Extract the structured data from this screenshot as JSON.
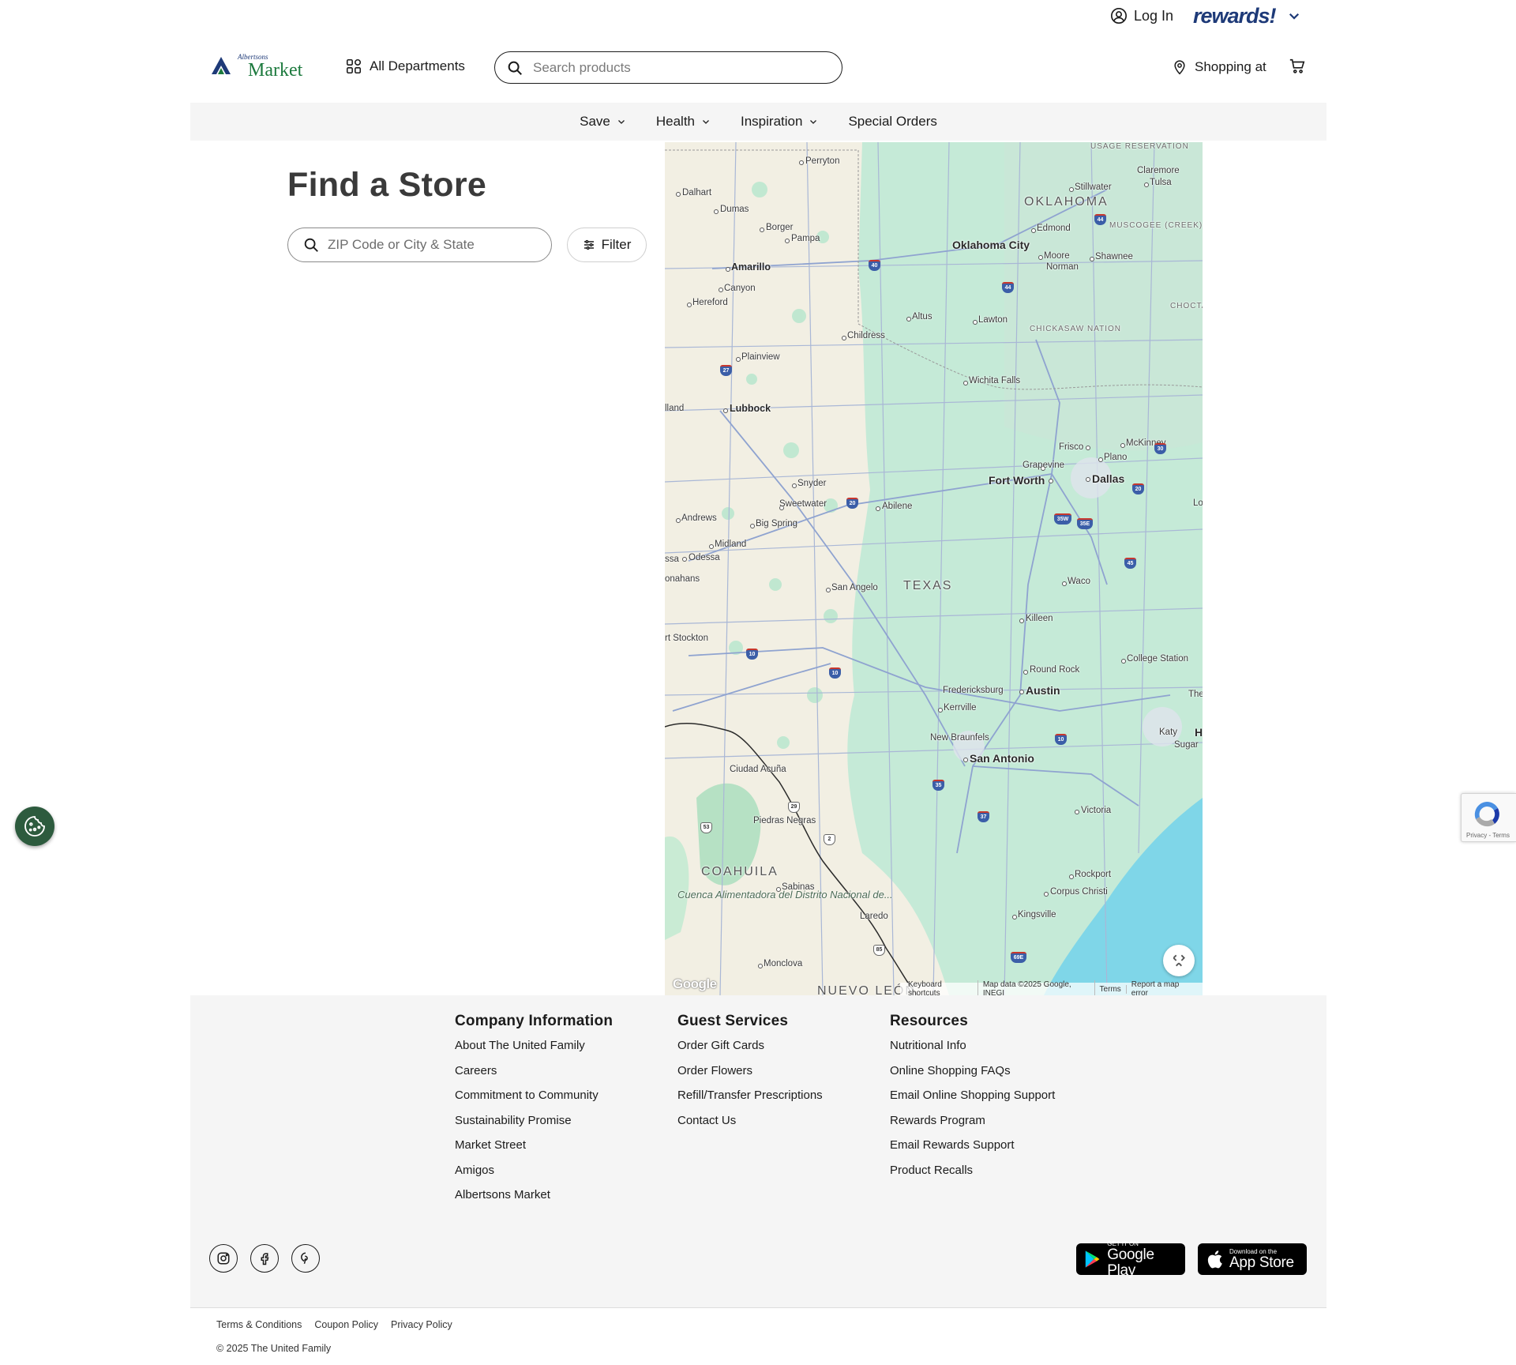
{
  "util": {
    "login_label": "Log In",
    "rewards_label": "rewards!"
  },
  "header": {
    "logo_top": "Albertsons",
    "logo_main": "Market",
    "all_departments": "All Departments",
    "search_placeholder": "Search products",
    "shopping_at": "Shopping at"
  },
  "nav": {
    "items": [
      {
        "label": "Save"
      },
      {
        "label": "Health"
      },
      {
        "label": "Inspiration"
      },
      {
        "label": "Special Orders"
      }
    ]
  },
  "store_finder": {
    "title": "Find a Store",
    "zip_placeholder": "ZIP Code or City & State",
    "filter_label": "Filter"
  },
  "map": {
    "labels": {
      "state_ok": "OKLAHOMA",
      "state_tx": "TEXAS",
      "coahuila": "COAHUILA",
      "nuevo_leon": "NUEVO LEÓN",
      "usage_res": "USAGE RESERVATION",
      "muscogee": "MUSCOGEE (CREEK) NATION",
      "chickasaw": "CHICKASAW NATION",
      "choctaw": "CHOCTA NATIO",
      "cuenca": "Cuenca Alimentadora del Distrito Nacional de...",
      "perryton": "Perryton",
      "dalhart": "Dalhart",
      "dumas": "Dumas",
      "borger": "Borger",
      "pampa": "Pampa",
      "amarillo": "Amarillo",
      "canyon": "Canyon",
      "hereford": "Hereford",
      "plainview": "Plainview",
      "lubbock": "Lubbock",
      "levelland": "lland",
      "snyder": "Snyder",
      "sweetwater": "Sweetwater",
      "abilene": "Abilene",
      "andrews": "Andrews",
      "big_spring": "Big Spring",
      "midland": "Midland",
      "odessa": "Odessa",
      "odessa_left": "ssa",
      "monahans": "onahans",
      "san_angelo": "San Angelo",
      "fort_stockton": "rt Stockton",
      "childress": "Childress",
      "altus": "Altus",
      "lawton": "Lawton",
      "wichita_falls": "Wichita Falls",
      "oklahoma_city": "Oklahoma City",
      "edmond": "Edmond",
      "moore": "Moore",
      "norman": "Norman",
      "shawnee": "Shawnee",
      "stillwater": "Stillwater",
      "tulsa": "Tulsa",
      "claremore": "Claremore",
      "frisco": "Frisco",
      "mckinney": "McKinney",
      "plano": "Plano",
      "grapevine": "Grapevine",
      "fort_worth": "Fort Worth",
      "dallas": "Dallas",
      "waco": "Waco",
      "killeen": "Killeen",
      "round_rock": "Round Rock",
      "austin": "Austin",
      "college_station": "College Station",
      "fredericksburg": "Fredericksburg",
      "kerrville": "Kerrville",
      "new_braunfels": "New Braunfels",
      "san_antonio": "San Antonio",
      "katy": "Katy",
      "sugar_land": "Sugar",
      "the_wo": "The Wo",
      "houston_h": "H",
      "victoria": "Victoria",
      "ciudad_acuna": "Ciudad Acuña",
      "piedras_negras": "Piedras Negras",
      "sabinas": "Sabinas",
      "laredo": "Laredo",
      "monclova": "Monclova",
      "rockport": "Rockport",
      "corpus_christi": "Corpus Christi",
      "kingsville": "Kingsville",
      "lo": "Lo"
    },
    "shields": [
      "40",
      "44",
      "44",
      "27",
      "30",
      "20",
      "20",
      "35W",
      "35E",
      "45",
      "10",
      "10",
      "10",
      "35",
      "37",
      "69E",
      "85",
      "29",
      "53",
      "2"
    ],
    "footer": {
      "google": "Google",
      "shortcuts": "Keyboard shortcuts",
      "map_data": "Map data ©2025 Google, INEGI",
      "terms": "Terms",
      "report": "Report a map error"
    }
  },
  "footer": {
    "company": {
      "title": "Company Information",
      "links": [
        "About The United Family",
        "Careers",
        "Commitment to Community",
        "Sustainability Promise",
        "Market Street",
        "Amigos",
        "Albertsons Market"
      ]
    },
    "guest": {
      "title": "Guest Services",
      "links": [
        "Order Gift Cards",
        "Order Flowers",
        "Refill/Transfer Prescriptions",
        "Contact Us"
      ]
    },
    "resources": {
      "title": "Resources",
      "links": [
        "Nutritional Info",
        "Online Shopping FAQs",
        "Email Online Shopping Support",
        "Rewards Program",
        "Email Rewards Support",
        "Product Recalls"
      ]
    },
    "google_play": {
      "small": "GET IT ON",
      "big": "Google Play"
    },
    "app_store": {
      "small": "Download on the",
      "big": "App Store"
    },
    "legal": [
      "Terms & Conditions",
      "Coupon Policy",
      "Privacy Policy"
    ],
    "copyright": "© 2025 The United Family"
  },
  "recaptcha": {
    "text": "Privacy - Terms"
  },
  "colors": {
    "brand_blue": "#1e3a78",
    "brand_green": "#1d7a3e",
    "cookie_green": "#2d5b3e",
    "map_green": "#b9e5cd",
    "water": "#7fd6e8"
  }
}
